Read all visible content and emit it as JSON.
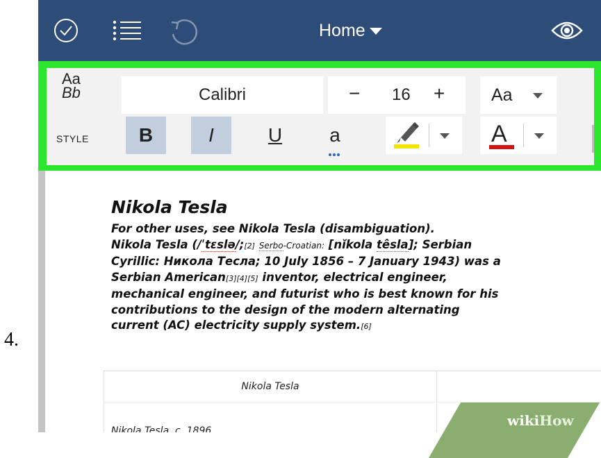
{
  "step_number": "4.",
  "toolbar": {
    "home_label": "Home",
    "colors": {
      "bar": "#2d4c77",
      "ribbon_highlight": "#2ee52e"
    }
  },
  "ribbon": {
    "style_sample_top": "Aa",
    "style_sample_bottom": "Bb",
    "style_label": "STYLE",
    "font_name": "Calibri",
    "font_size_minus": "−",
    "font_size": "16",
    "font_size_plus": "+",
    "case_label": "Aa",
    "bold": "B",
    "italic": "I",
    "underline": "U",
    "subscript": "a",
    "font_color_label": "A",
    "highlight_color": "#f3e500",
    "font_color": "#d31212"
  },
  "document": {
    "title": "Nikola Tesla",
    "line1": "For other uses, see Nikola Tesla (disambiguation).",
    "line2a": "Nikola Tesla (/",
    "line2_ipa": "ˈtɛslə",
    "line2b": "/;",
    "line2_ref": "[2]",
    "line2_sc": "Serbo",
    "line2c": "-Croatian:",
    "line2d": " [nǐkola ",
    "line2_tesla": "têsla",
    "line2e": "]; Serbian",
    "line3": "Cyrillic: Никола Тесла; 10 July 1856 – 7 January 1943) was a",
    "line4a": "Serbian American",
    "line4_refs": "[3][4][5]",
    "line4b": " inventor, electrical engineer,",
    "line5": "mechanical engineer, and futurist who is best known for his",
    "line6": "contributions to the design of the modern alternating",
    "line7a": "current (AC) electricity supply system.",
    "line7_ref": "[6]",
    "table_header": "Nikola Tesla",
    "table_cell": "Nikola Tesla, c. 1896"
  },
  "watermark": {
    "part1": "wiki",
    "part2": "How"
  }
}
